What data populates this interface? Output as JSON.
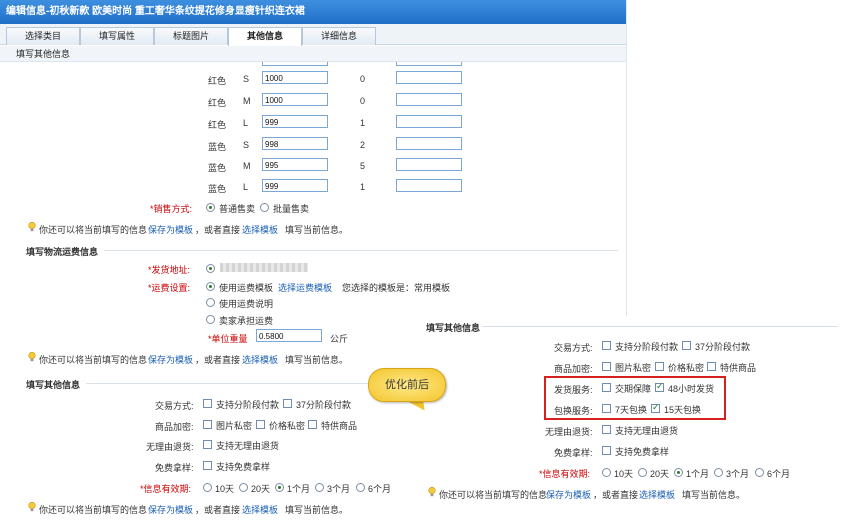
{
  "window": {
    "title": "编辑信息-初秋新款 欧美时尚 重工奢华条纹提花修身显瘦针织连衣裙"
  },
  "tabs": [
    {
      "label": "选择类目"
    },
    {
      "label": "填写属性"
    },
    {
      "label": "标题图片"
    },
    {
      "label": "其他信息"
    },
    {
      "label": "详细信息"
    }
  ],
  "section_bar": "填写其他信息",
  "sku_rows": [
    {
      "color": "红色",
      "size": "S",
      "stock": "1000",
      "count": "0"
    },
    {
      "color": "红色",
      "size": "M",
      "stock": "1000",
      "count": "0"
    },
    {
      "color": "红色",
      "size": "L",
      "stock": "999",
      "count": "1"
    },
    {
      "color": "蓝色",
      "size": "S",
      "stock": "998",
      "count": "2"
    },
    {
      "color": "蓝色",
      "size": "M",
      "stock": "995",
      "count": "5"
    },
    {
      "color": "蓝色",
      "size": "L",
      "stock": "999",
      "count": "1"
    }
  ],
  "sales": {
    "label": "*销售方式:",
    "opt1": "普通售卖",
    "opt2": "批量售卖"
  },
  "tip": {
    "prefix": "你还可以将当前填写的信息",
    "save": "保存为模板",
    "mid": "，或者直接",
    "choose": "选择模板",
    "suffix": "填写当前信息。"
  },
  "logistics": {
    "heading": "填写物流运费信息",
    "address_label": "*发货地址:",
    "freight_label": "*运费设置:",
    "use_template": "使用运费模板",
    "choose_template": "选择运费模板",
    "chosen_text": "您选择的模板是：常用模板",
    "use_desc": "使用运费说明",
    "seller_pays": "卖家承担运费",
    "unit_weight_label": "*单位重量",
    "unit_weight_value": "0.5800",
    "unit": "公斤"
  },
  "other_left": {
    "heading": "填写其他信息",
    "trade_label": "交易方式:",
    "trade_opt1": "支持分阶段付款",
    "trade_opt2": "37分阶段付款",
    "goods_label": "商品加密:",
    "goods_opt1": "图片私密",
    "goods_opt2": "价格私密",
    "goods_opt3": "特供商品",
    "return_label": "无理由退货:",
    "return_opt": "支持无理由退货",
    "sample_label": "免费拿样:",
    "sample_opt": "支持免费拿样",
    "valid_label": "*信息有效期:",
    "valid_opts": [
      "10天",
      "20天",
      "1个月",
      "3个月",
      "6个月"
    ]
  },
  "bubble": "优化前后",
  "other_right": {
    "heading": "填写其他信息",
    "trade_label": "交易方式:",
    "trade_opt1": "支持分阶段付款",
    "trade_opt2": "37分阶段付款",
    "goods_label": "商品加密:",
    "goods_opt1": "图片私密",
    "goods_opt2": "价格私密",
    "goods_opt3": "特供商品",
    "ship_label": "发货服务:",
    "ship_opt1": "交期保障",
    "ship_opt2": "48小时发货",
    "pack_label": "包换服务:",
    "pack_opt1": "7天包换",
    "pack_opt2": "15天包换",
    "return_label": "无理由退货:",
    "return_opt": "支持无理由退货",
    "sample_label": "免费拿样:",
    "sample_opt": "支持免费拿样",
    "valid_label": "*信息有效期:",
    "valid_opts": [
      "10天",
      "20天",
      "1个月",
      "3个月",
      "6个月"
    ]
  },
  "colors": {
    "titlebar": "#2a7fd6",
    "link": "#1a5fb4",
    "required": "#cc0000",
    "highlight_box": "#d62020",
    "bubble": "#f3c52c"
  }
}
